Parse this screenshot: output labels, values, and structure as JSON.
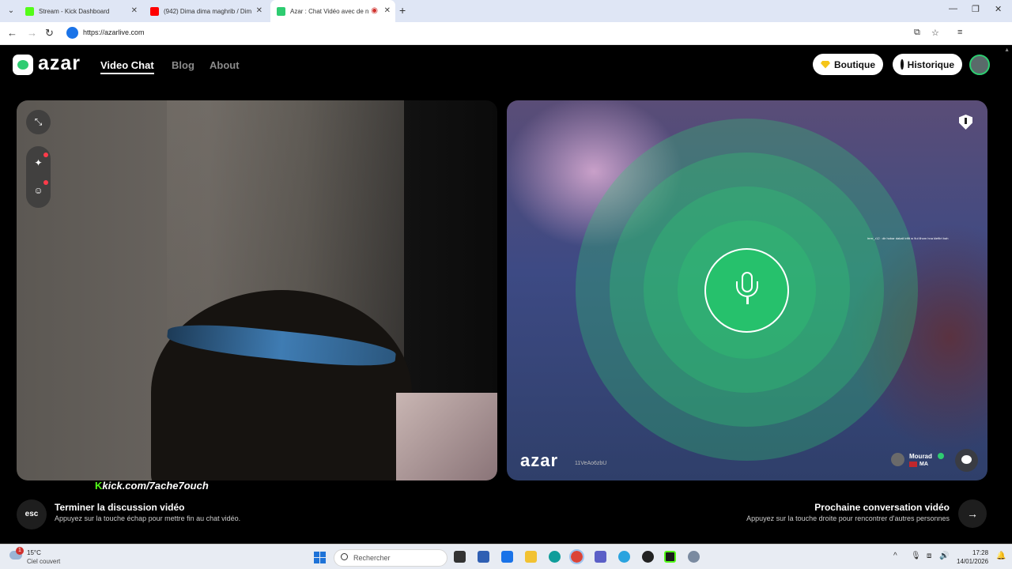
{
  "browser": {
    "tabs": [
      {
        "title": "Stream - Kick Dashboard",
        "favicon_color": "#53fc18"
      },
      {
        "title": "(942) Dima dima maghrib / Dim",
        "favicon_color": "#ff0000"
      },
      {
        "title": "Azar : Chat Vidéo avec de n",
        "favicon_color": "#2ecc71",
        "active": true
      }
    ],
    "new_tab_label": "+",
    "url": "https://azarlive.com"
  },
  "site": {
    "logo_text": "azar",
    "nav": {
      "video_chat": "Video Chat",
      "blog": "Blog",
      "about": "About"
    },
    "boutique_label": "Boutique",
    "historique_label": "Historique"
  },
  "remote": {
    "caption": "irrrrr_r12 : dir hobar dakali triftt w 9ul lihom hna kleftirt bah",
    "watermark_logo": "azar",
    "watermark_id": "11VeAo6zbU",
    "peer_name": "Mourad",
    "peer_country": "MA"
  },
  "overlay": {
    "kick_label": "kick.com/7ache7ouch"
  },
  "hints": {
    "esc_key": "esc",
    "end_title": "Terminer la discussion vidéo",
    "end_sub": "Appuyez sur la touche échap pour mettre fin au chat vidéo.",
    "next_title": "Prochaine conversation vidéo",
    "next_sub": "Appuyez sur la touche droite pour rencontrer d'autres personnes",
    "next_arrow": "→"
  },
  "taskbar": {
    "weather_badge": "1",
    "weather_temp": "15°C",
    "weather_desc": "Ciel couvert",
    "search_placeholder": "Rechercher",
    "time": "17:28",
    "date": "14/01/2026"
  }
}
